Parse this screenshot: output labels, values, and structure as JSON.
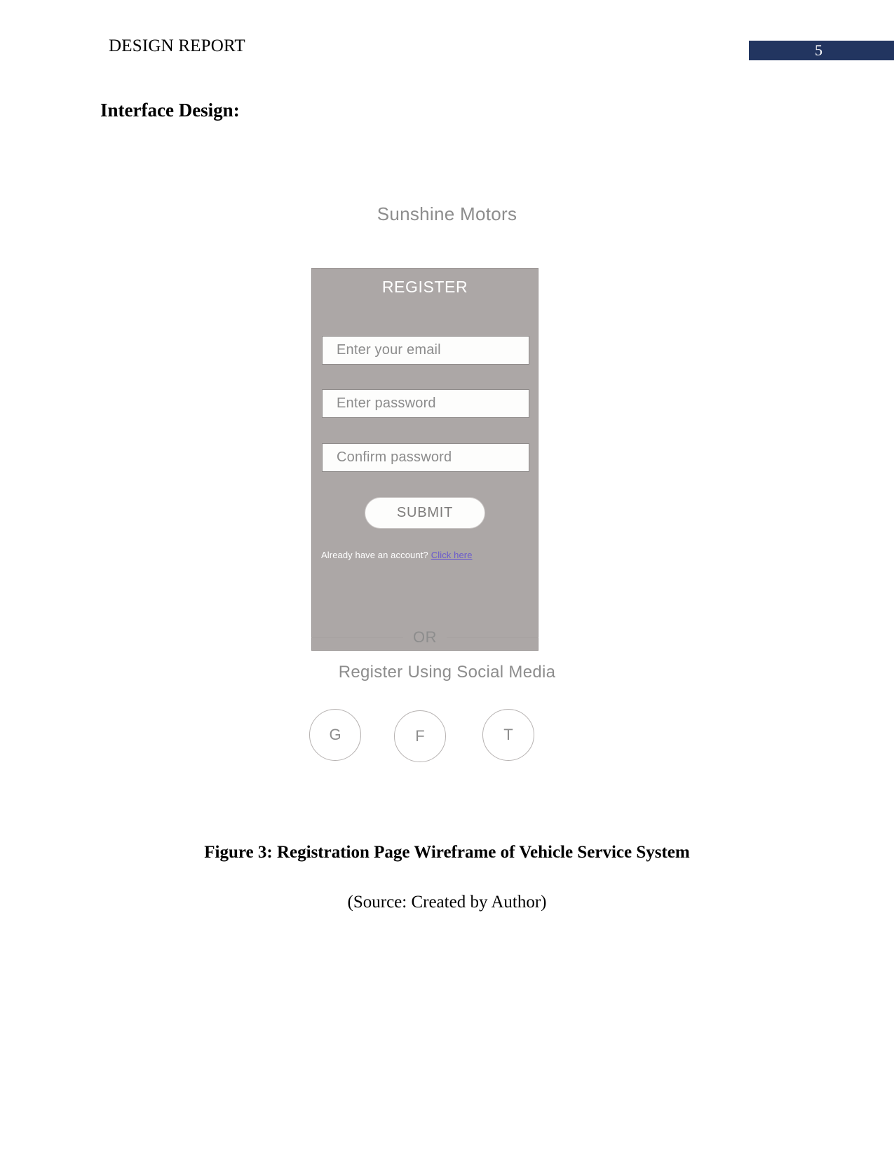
{
  "header": {
    "document_title": "DESIGN REPORT",
    "page_number": "5",
    "badge_color": "#223560"
  },
  "section": {
    "heading": "Interface Design:"
  },
  "wireframe": {
    "brand": "Sunshine Motors",
    "card": {
      "title": "REGISTER",
      "background_color": "#aca7a6",
      "fields": [
        {
          "name": "email",
          "placeholder": "Enter your email",
          "value": ""
        },
        {
          "name": "password",
          "placeholder": "Enter password",
          "value": ""
        },
        {
          "name": "confirm_password",
          "placeholder": "Confirm password",
          "value": ""
        }
      ],
      "submit_label": "SUBMIT",
      "account_prompt": "Already have an account?",
      "account_link": "Click here",
      "link_color": "#6a5acd"
    },
    "divider_text": "OR",
    "social_label": "Register Using Social Media",
    "social_buttons": [
      {
        "name": "google",
        "glyph": "G"
      },
      {
        "name": "facebook",
        "glyph": "F"
      },
      {
        "name": "twitter",
        "glyph": "T"
      }
    ]
  },
  "figure": {
    "caption": "Figure 3: Registration Page Wireframe of Vehicle Service System",
    "source": "(Source: Created by Author)"
  }
}
